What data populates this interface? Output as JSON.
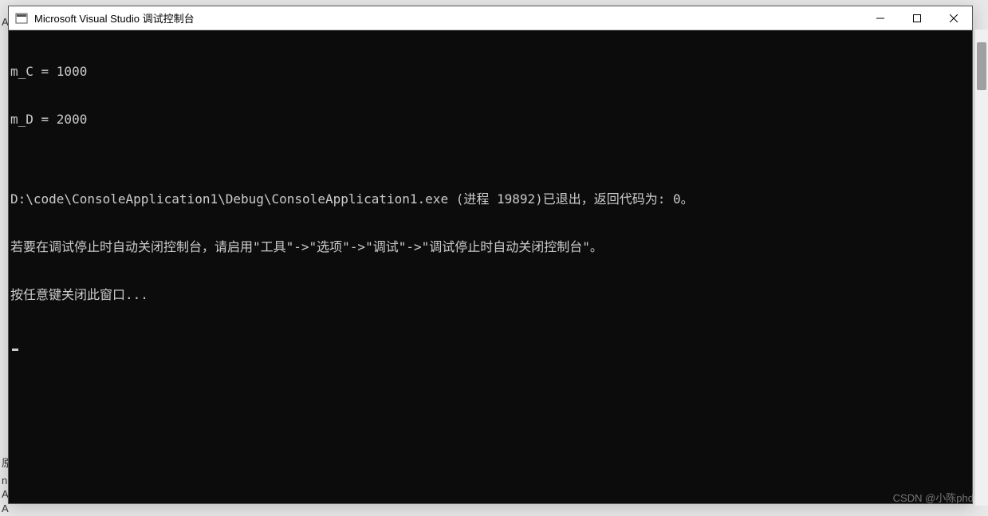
{
  "background": {
    "letter_a_top": "A",
    "partial_line1": "原",
    "partial_line2": "n",
    "partial_line3": "A",
    "bottom_partial": "A"
  },
  "window": {
    "title": "Microsoft Visual Studio 调试控制台"
  },
  "console": {
    "lines": [
      "m_C = 1000",
      "m_D = 2000",
      "",
      "D:\\code\\ConsoleApplication1\\Debug\\ConsoleApplication1.exe (进程 19892)已退出，返回代码为: 0。",
      "若要在调试停止时自动关闭控制台，请启用\"工具\"->\"选项\"->\"调试\"->\"调试停止时自动关闭控制台\"。",
      "按任意键关闭此窗口..."
    ]
  },
  "watermark": "CSDN @小陈phd"
}
